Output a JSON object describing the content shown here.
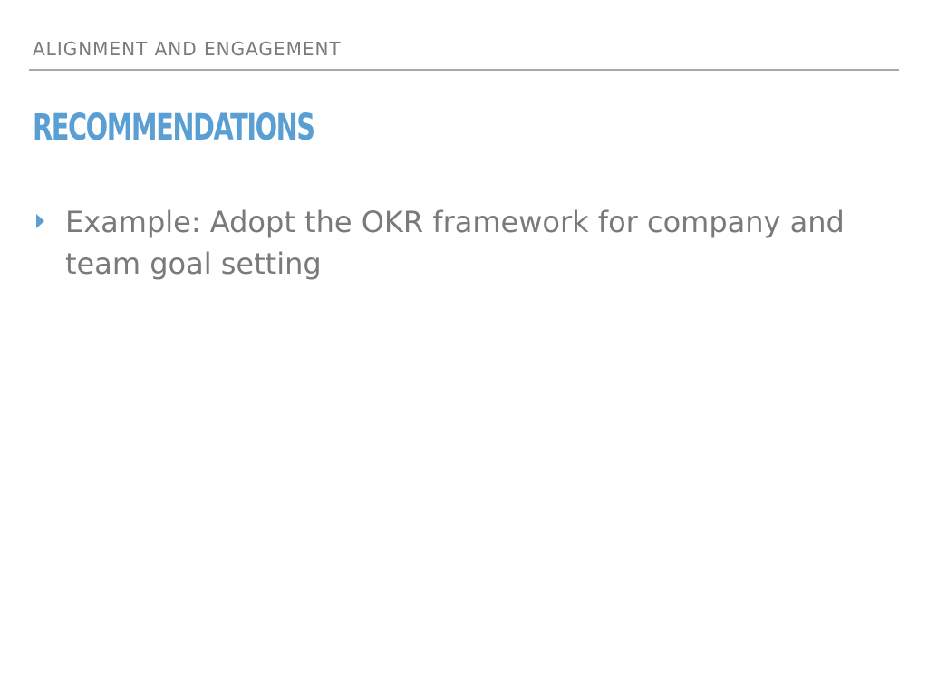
{
  "slide": {
    "section_header": "ALIGNMENT AND ENGAGEMENT",
    "title": "RECOMMENDATIONS",
    "bullets": [
      {
        "text": "Example: Adopt the OKR framework for company and team goal setting"
      }
    ]
  },
  "colors": {
    "title": "#5a9fd4",
    "body_text": "#7a7a7a",
    "rule": "#a8a8a8",
    "bullet": "#5a9fd4",
    "background": "#ffffff"
  },
  "icons": {
    "bullet": "right-triangle-icon"
  }
}
